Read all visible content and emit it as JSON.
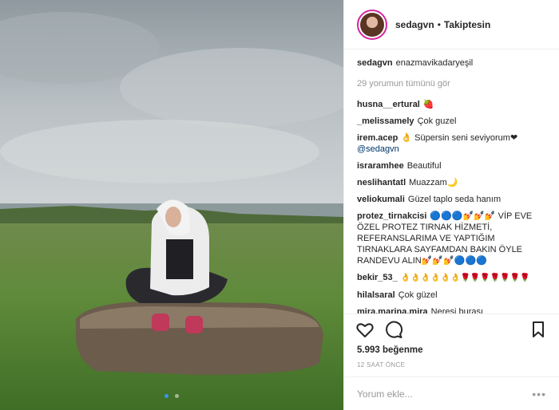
{
  "header": {
    "username": "sedagvn",
    "separator": "•",
    "follow_label": "Takiptesin"
  },
  "caption": {
    "username": "sedagvn",
    "text": "enazmavikadaryeşil"
  },
  "view_all_comments": "29 yorumun tümünü gör",
  "comments": [
    {
      "user": "husna__ertural",
      "text": "🍓"
    },
    {
      "user": "_melissamely",
      "text": "Çok guzel"
    },
    {
      "user": "irem.acep",
      "text": "👌 Süpersin seni seviyorum❤",
      "mention": "@sedagvn"
    },
    {
      "user": "israramhee",
      "text": "Beautiful"
    },
    {
      "user": "neslihantatl",
      "text": "Muazzam🌙"
    },
    {
      "user": "veliokumali",
      "text": "Güzel taplo seda hanım"
    },
    {
      "user": "protez_tirnakcisi",
      "text": "🔵🔵🔵💅💅💅 VİP EVE ÖZEL PROTEZ TIRNAK HİZMETİ, REFERANSLARIMA VE YAPTIĞIM TIRNAKLARA SAYFAMDAN BAKIN ÖYLE RANDEVU ALIN💅💅💅🔵🔵🔵"
    },
    {
      "user": "bekir_53_",
      "text": "👌👌👌👌👌👌🌹🌹🌹🌹🌹🌹🌹"
    },
    {
      "user": "hilalsaral",
      "text": "Çok güzel"
    },
    {
      "user": "mira.marina.mira",
      "text": "Neresi burası"
    }
  ],
  "actions": {
    "like_icon": "heart-icon",
    "comment_icon": "comment-icon",
    "save_icon": "bookmark-icon"
  },
  "likes": "5.993 beğenme",
  "timestamp": "12 SAAT ÖNCE",
  "add_comment": {
    "placeholder": "Yorum ekle...",
    "more": "•••"
  },
  "carousel": {
    "total": 2,
    "active": 1
  },
  "colors": {
    "accent": "#3897f0",
    "text": "#262626",
    "muted": "#999999"
  }
}
